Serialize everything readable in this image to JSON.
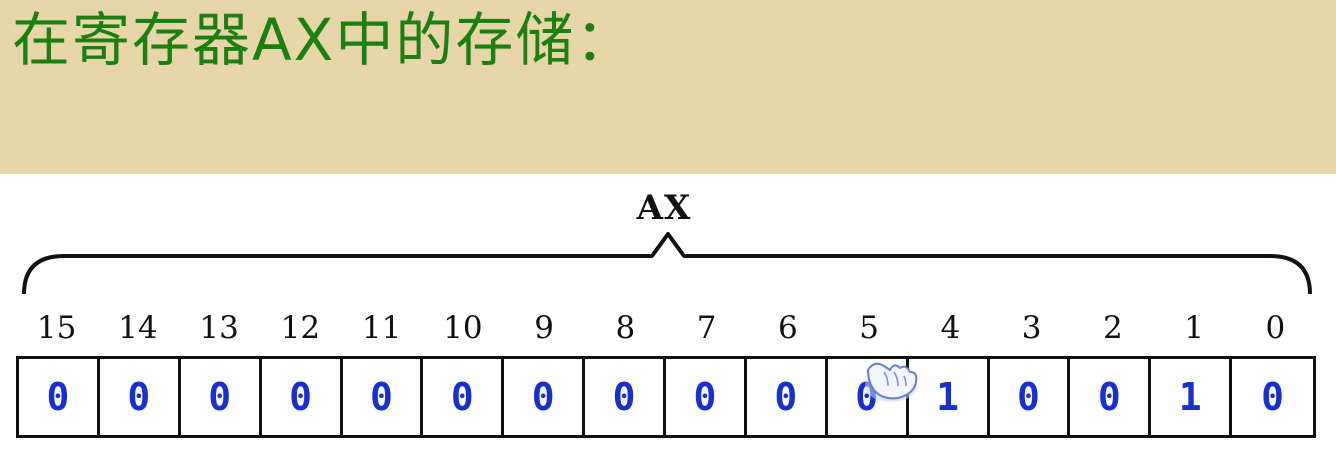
{
  "heading": "在寄存器AX中的存储：",
  "register": {
    "name": "AX",
    "bit_indices": [
      "15",
      "14",
      "13",
      "12",
      "11",
      "10",
      "9",
      "8",
      "7",
      "6",
      "5",
      "4",
      "3",
      "2",
      "1",
      "0"
    ],
    "bit_values": [
      "0",
      "0",
      "0",
      "0",
      "0",
      "0",
      "0",
      "0",
      "0",
      "0",
      "0",
      "1",
      "0",
      "0",
      "1",
      "0"
    ]
  },
  "colors": {
    "background": "#e9d5aa",
    "heading_text": "#1b7f12",
    "bit_value_text": "#1a2fd1",
    "panel": "#ffffff"
  },
  "icons": {
    "pointer": "hand-cursor-icon"
  }
}
